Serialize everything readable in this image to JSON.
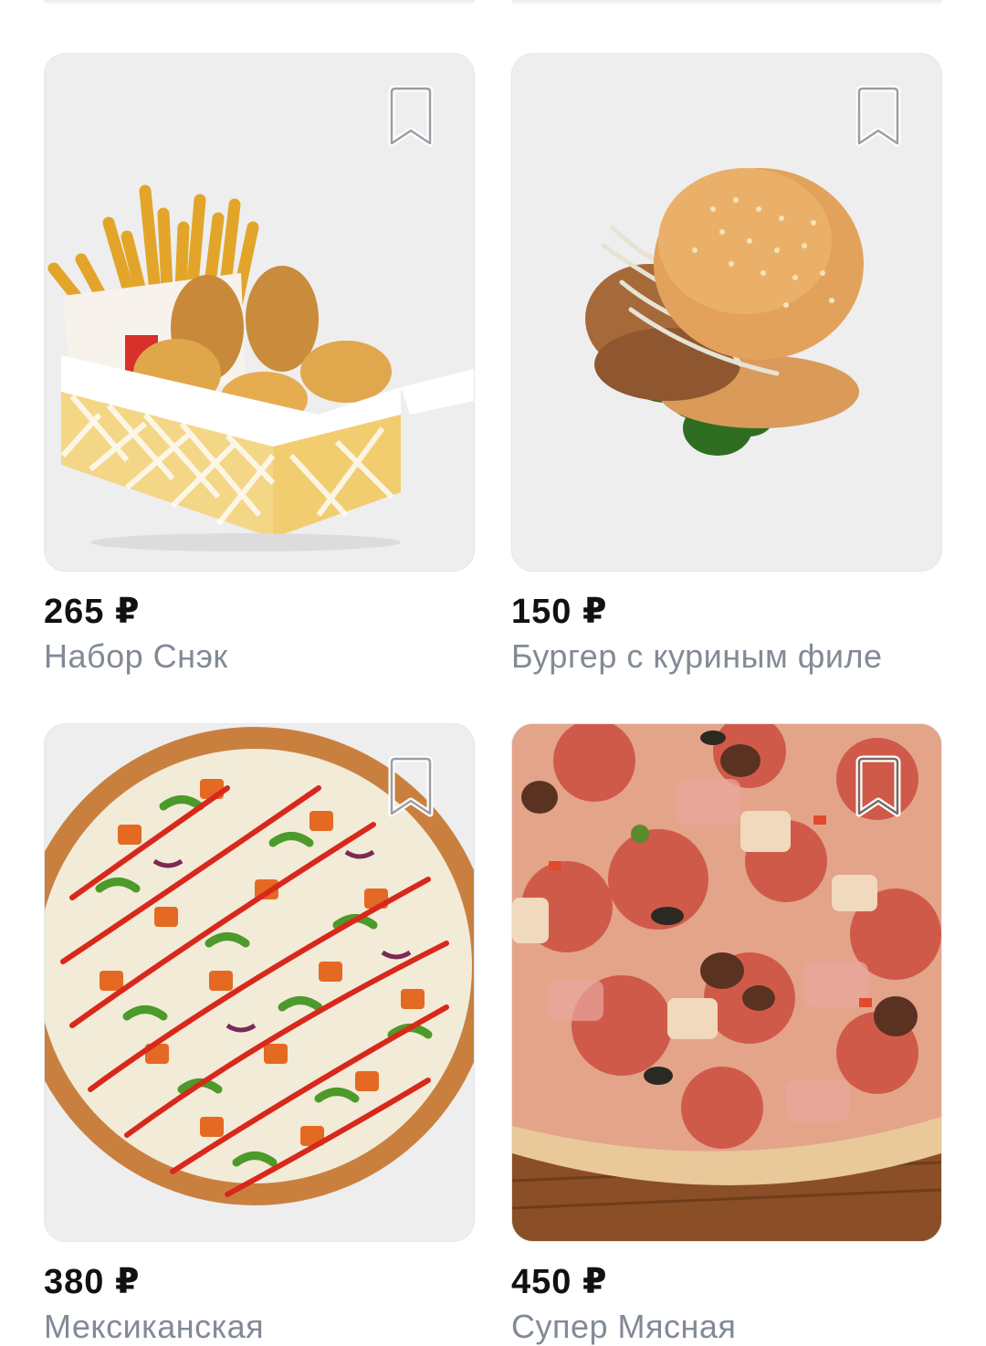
{
  "products": [
    {
      "price": "265 ₽",
      "title": "Набор Снэк",
      "image": "snack-box-fries-nuggets",
      "bookmark_icon": "bookmark-icon"
    },
    {
      "price": "150 ₽",
      "title": "Бургер с куриным филе",
      "image": "chicken-burger",
      "bookmark_icon": "bookmark-icon"
    },
    {
      "price": "380 ₽",
      "title": "Мексиканская",
      "image": "mexican-pizza",
      "bookmark_icon": "bookmark-icon"
    },
    {
      "price": "450 ₽",
      "title": "Супер Мясная",
      "image": "meat-pizza",
      "bookmark_icon": "bookmark-icon"
    }
  ],
  "colors": {
    "price_text": "#111111",
    "title_text": "#828a96",
    "card_background": "#f0f0f1",
    "card_border": "#e4e6e9"
  }
}
